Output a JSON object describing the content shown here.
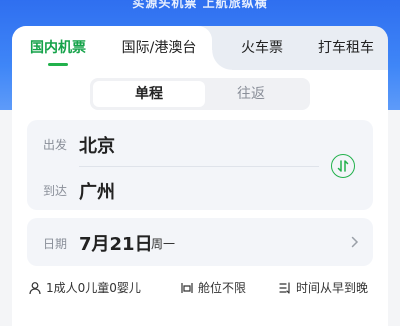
{
  "hero": {
    "slogan": "买源头机票 上航旅纵横"
  },
  "tabs": [
    {
      "label": "国内机票",
      "active": true
    },
    {
      "label": "国际/港澳台",
      "active": false
    },
    {
      "label": "火车票",
      "active": false
    },
    {
      "label": "打车租车",
      "active": false
    }
  ],
  "trip_type": {
    "options": [
      "单程",
      "往返"
    ],
    "selected": "单程"
  },
  "route": {
    "from_label": "出发",
    "from_city": "北京",
    "to_label": "到达",
    "to_city": "广州",
    "swap_icon": "swap-arrows-icon"
  },
  "date": {
    "label": "日期",
    "value": "7月21日",
    "weekday": "周一"
  },
  "filters": {
    "passengers": "1成人0儿童0婴儿",
    "cabin": "舱位不限",
    "sort": "时间从早到晚"
  },
  "colors": {
    "accent": "#22b14c",
    "hero": "#2f6ff0"
  }
}
